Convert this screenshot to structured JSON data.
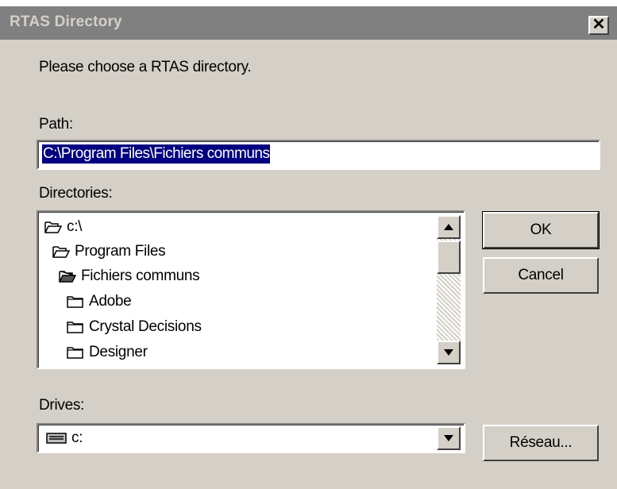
{
  "window": {
    "title": "RTAS Directory",
    "close_label": "✕"
  },
  "dialog": {
    "prompt": "Please choose a RTAS directory.",
    "path_label": "Path:",
    "path_value": "C:\\Program Files\\Fichiers communs",
    "directories_label": "Directories:",
    "directories": [
      {
        "label": "c:\\",
        "icon": "open-folder-icon"
      },
      {
        "label": "Program Files",
        "icon": "open-folder-icon"
      },
      {
        "label": "Fichiers communs",
        "icon": "open-folder-filled-icon"
      },
      {
        "label": "Adobe",
        "icon": "folder-icon"
      },
      {
        "label": "Crystal Decisions",
        "icon": "folder-icon"
      },
      {
        "label": "Designer",
        "icon": "folder-icon"
      }
    ],
    "drives_label": "Drives:",
    "drive_selected": "c:",
    "drive_icon": "drive-icon"
  },
  "buttons": {
    "ok": "OK",
    "cancel": "Cancel",
    "network": "Réseau..."
  },
  "colors": {
    "face": "#d4d0c8",
    "titlebar_inactive": "#808080",
    "selection": "#000080"
  }
}
